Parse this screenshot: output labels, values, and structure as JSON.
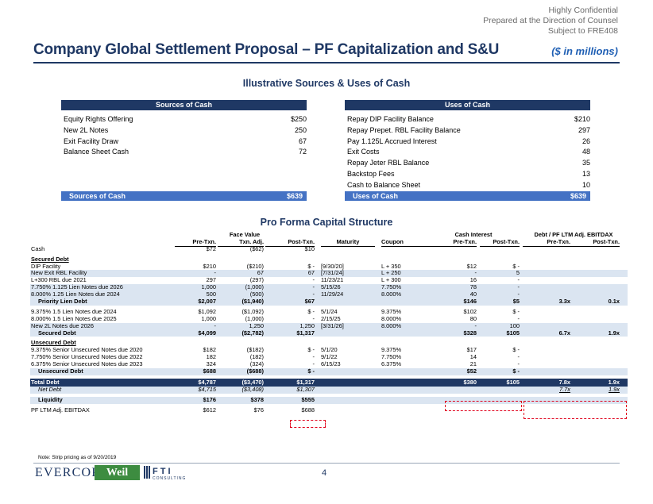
{
  "header": {
    "confidential": [
      "Highly Confidential",
      "Prepared at the Direction of Counsel",
      "Subject to FRE408"
    ],
    "title": "Company Global Settlement Proposal – PF Capitalization and S&U",
    "units": "($ in millions)"
  },
  "sources_uses": {
    "section_title": "Illustrative Sources & Uses of Cash",
    "sources": {
      "header": "Sources of Cash",
      "items": [
        {
          "label": "Equity Rights Offering",
          "value": "$250"
        },
        {
          "label": "New 2L Notes",
          "value": "250"
        },
        {
          "label": "Exit Facility Draw",
          "value": "67"
        },
        {
          "label": "Balance Sheet Cash",
          "value": "72"
        }
      ],
      "total_label": "Sources of Cash",
      "total_value": "$639"
    },
    "uses": {
      "header": "Uses of Cash",
      "items": [
        {
          "label": "Repay DIP Facility Balance",
          "value": "$210"
        },
        {
          "label": "Repay Prepet. RBL Facility Balance",
          "value": "297"
        },
        {
          "label": "Pay 1.125L Accrued Interest",
          "value": "26"
        },
        {
          "label": "Exit Costs",
          "value": "48"
        },
        {
          "label": "Repay Jeter RBL Balance",
          "value": "35"
        },
        {
          "label": "Backstop Fees",
          "value": "13"
        },
        {
          "label": "Cash to Balance Sheet",
          "value": "10"
        }
      ],
      "total_label": "Uses of Cash",
      "total_value": "$639"
    }
  },
  "capital_structure": {
    "section_title": "Pro Forma Capital Structure",
    "group_headers": {
      "face_value": "Face Value",
      "cash_interest": "Cash Interest",
      "leverage": "Debt / PF LTM Adj. EBITDAX"
    },
    "columns": [
      "Pre-Txn.",
      "Txn. Adj.",
      "Post-Txn.",
      "Maturity",
      "Coupon",
      "Pre-Txn.",
      "Post-Txn.",
      "Pre-Txn.",
      "Post-Txn."
    ],
    "rows": [
      {
        "type": "row",
        "cells": [
          "Cash",
          "$72",
          "($62)",
          "$10",
          "",
          "",
          "",
          "",
          "",
          ""
        ]
      },
      {
        "type": "spacer"
      },
      {
        "type": "section",
        "cells": [
          "Secured Debt"
        ]
      },
      {
        "type": "row",
        "cells": [
          "DIP Facility",
          "$210",
          "($210)",
          "$ -",
          "[9/30/20]",
          "L + 350",
          "$12",
          "$ -",
          "",
          ""
        ]
      },
      {
        "type": "row",
        "shade": true,
        "cells": [
          "New Exit RBL Facility",
          "-",
          "67",
          "67",
          "[7/31/24]",
          "L + 250",
          "-",
          "5",
          "",
          ""
        ]
      },
      {
        "type": "row",
        "cells": [
          "L+300 RBL due 2021",
          "297",
          "(297)",
          "-",
          "11/23/21",
          "L + 300",
          "16",
          "-",
          "",
          ""
        ]
      },
      {
        "type": "row",
        "shade": true,
        "cells": [
          "7.750% 1.125 Lien Notes due 2026",
          "1,000",
          "(1,000)",
          "-",
          "5/15/26",
          "7.750%",
          "78",
          "-",
          "",
          ""
        ]
      },
      {
        "type": "row",
        "shade": true,
        "cells": [
          "8.000% 1.25 Lien Notes due 2024",
          "500",
          "(500)",
          "-",
          "11/29/24",
          "8.000%",
          "40",
          "-",
          "",
          ""
        ]
      },
      {
        "type": "subtotal",
        "shade": true,
        "cells": [
          "Priority Lien Debt",
          "$2,007",
          "($1,940)",
          "$67",
          "",
          "",
          "$146",
          "$5",
          "3.3x",
          "0.1x"
        ]
      },
      {
        "type": "spacer"
      },
      {
        "type": "row",
        "cells": [
          "9.375% 1.5 Lien Notes due 2024",
          "$1,092",
          "($1,092)",
          "$ -",
          "5/1/24",
          "9.375%",
          "$102",
          "$ -",
          "",
          ""
        ]
      },
      {
        "type": "row",
        "cells": [
          "8.000% 1.5 Lien Notes due 2025",
          "1,000",
          "(1,000)",
          "-",
          "2/15/25",
          "8.000%",
          "80",
          "-",
          "",
          ""
        ]
      },
      {
        "type": "row",
        "shade": true,
        "cells": [
          "New 2L Notes due 2026",
          "-",
          "1,250",
          "1,250",
          "[3/31/26]",
          "8.000%",
          "-",
          "100",
          "",
          ""
        ]
      },
      {
        "type": "subtotal",
        "shade": true,
        "cells": [
          "Secured Debt",
          "$4,099",
          "($2,782)",
          "$1,317",
          "",
          "",
          "$328",
          "$105",
          "6.7x",
          "1.9x"
        ]
      },
      {
        "type": "spacer"
      },
      {
        "type": "section",
        "cells": [
          "Unsecured Debt"
        ]
      },
      {
        "type": "row",
        "cells": [
          "9.375% Senior Unsecured Notes due 2020",
          "$182",
          "($182)",
          "$ -",
          "5/1/20",
          "9.375%",
          "$17",
          "$ -",
          "",
          ""
        ]
      },
      {
        "type": "row",
        "cells": [
          "7.750% Senior Unsecured Notes due 2022",
          "182",
          "(182)",
          "-",
          "9/1/22",
          "7.750%",
          "14",
          "-",
          "",
          ""
        ]
      },
      {
        "type": "row",
        "cells": [
          "6.375% Senior Unsecured Notes due 2023",
          "324",
          "(324)",
          "-",
          "6/15/23",
          "6.375%",
          "21",
          "-",
          "",
          ""
        ]
      },
      {
        "type": "subtotal",
        "shade": true,
        "cells": [
          "Unsecured Debt",
          "$688",
          "($688)",
          "$ -",
          "",
          "",
          "$52",
          "$ -",
          "",
          ""
        ]
      },
      {
        "type": "spacer"
      },
      {
        "type": "total",
        "cells": [
          "Total Debt",
          "$4,787",
          "($3,470)",
          "$1,317",
          "",
          "",
          "$380",
          "$105",
          "7.8x",
          "1.9x"
        ]
      },
      {
        "type": "italic",
        "shade": true,
        "cells": [
          "Net Debt",
          "$4,715",
          "($3,408)",
          "$1,307",
          "",
          "",
          "",
          "",
          "7.7x",
          "1.9x"
        ]
      },
      {
        "type": "spacer"
      },
      {
        "type": "liquidity",
        "cells": [
          "Liquidity",
          "$176",
          "$378",
          "$555",
          "",
          "",
          "",
          "",
          "",
          ""
        ]
      },
      {
        "type": "spacer"
      },
      {
        "type": "row",
        "cells": [
          "PF LTM Adj. EBITDAX",
          "$612",
          "$76",
          "$688",
          "",
          "",
          "",
          "",
          "",
          ""
        ]
      }
    ]
  },
  "footer": {
    "note": "Note: Strip pricing as of 9/20/2019",
    "page_number": "4",
    "logos": {
      "evercore": "EVERCORE",
      "weil": "Weil",
      "fti": "F T I",
      "fti_sub": "CONSULTING"
    }
  }
}
